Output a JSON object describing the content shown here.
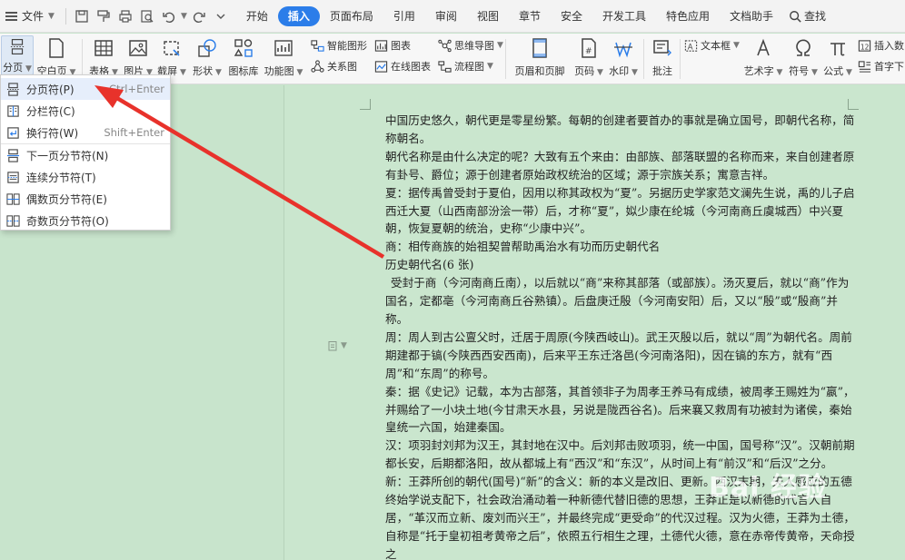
{
  "menubar": {
    "file_label": "文件",
    "tabs": [
      "开始",
      "插入",
      "页面布局",
      "引用",
      "审阅",
      "视图",
      "章节",
      "安全",
      "开发工具",
      "特色应用",
      "文档助手"
    ],
    "active_tab": "插入",
    "find_label": "查找"
  },
  "ribbon": {
    "page_break": "分页",
    "blank_page": "空白页",
    "table": "表格",
    "picture": "图片",
    "screenshot": "截屏",
    "shape": "形状",
    "icon_lib": "图标库",
    "function_chart": "功能图",
    "smart_art": "智能图形",
    "chart": "图表",
    "mind_map": "思维导图",
    "relation_chart": "关系图",
    "online_chart": "在线图表",
    "flow_chart": "流程图",
    "header_footer": "页眉和页脚",
    "page_number": "页码",
    "watermark": "水印",
    "comment": "批注",
    "text_box": "文本框",
    "word_art": "艺术字",
    "symbol": "符号",
    "formula": "公式",
    "insert_num": "插入数",
    "drop_cap": "首字下"
  },
  "dropdown": {
    "items": [
      {
        "label": "分页符(P)",
        "shortcut": "Ctrl+Enter"
      },
      {
        "label": "分栏符(C)",
        "shortcut": ""
      },
      {
        "label": "换行符(W)",
        "shortcut": "Shift+Enter"
      },
      {
        "label": "下一页分节符(N)",
        "shortcut": ""
      },
      {
        "label": "连续分节符(T)",
        "shortcut": ""
      },
      {
        "label": "偶数页分节符(E)",
        "shortcut": ""
      },
      {
        "label": "奇数页分节符(O)",
        "shortcut": ""
      }
    ]
  },
  "document": {
    "lines": [
      "中国历史悠久，朝代更是零星纷繁。每朝的创建者要首办的事就是确立国号，即朝代名称，简称朝名。",
      "朝代名称是由什么决定的呢？大致有五个来由：由部族、部落联盟的名称而来，来自创建者原有卦号、爵位；源于创建者原始政权统治的区域；源于宗族关系；寓意吉祥。",
      "夏：据传禹曾受封于夏伯，因用以称其政权为“夏”。另据历史学家范文澜先生说，禹的儿子启西迁大夏（山西南部汾浍一带）后，才称“夏”，姒少康在纶城（今河南商丘虞城西）中兴夏朝，恢复夏朝的统治，史称“少康中兴”。",
      "商：相传商族的始祖契曾帮助禹治水有功而历史朝代名",
      "历史朝代名(6 张)",
      "受封于商（今河南商丘南），以后就以“商”来称其部落（或部族）。汤灭夏后，就以“商”作为国名，定都亳（今河南商丘谷熟镇）。后盘庚迁殷（今河南安阳）后，又以“殷”或“殷商”并称。",
      "周：周人到古公亶父时，迁居于周原(今陕西岐山)。武王灭殷以后，就以“周”为朝代名。周前期建都于镐(今陕西西安西南)，后来平王东迁洛邑(今河南洛阳)，因在镐的东方，就有“西周”和“东周”的称号。",
      "秦：据《史记》记载，本为古部落，其首领非子为周孝王养马有成绩，被周孝王赐姓为“嬴”，并赐给了一小块土地(今甘肃天水县，另说是陇西谷名)。后来襄又救周有功被封为诸侯，秦始皇统一六国，始建秦国。",
      "汉：项羽封刘邦为汉王，其封地在汉中。后刘邦击败项羽，统一中国，国号称“汉”。汉朝前期都长安，后期都洛阳，故从都城上有“西汉”和“东汉”，从时间上有“前汉”和“后汉”之分。",
      "新：王莽所创的朝代(国号)“新”的含义：新的本义是改旧、更新。西汉末期，天人感应的五德终始学说支配下，社会政治涌动着一种新德代替旧德的思想，王莽正是以新德的代言人自居，“革汉而立新、废刘而兴王”，并最终完成“更受命”的代汉过程。汉为火德，王莽为土德，自称是“托于皇初祖考黄帝之后”，依照五行相生之理，土德代火德，意在赤帝传黄帝，天命授之"
    ]
  },
  "watermark_text": "Bai 经验",
  "colors": {
    "accent": "#2b7de9",
    "doc_background": "#c8e4cc",
    "arrow": "#e8322b"
  }
}
